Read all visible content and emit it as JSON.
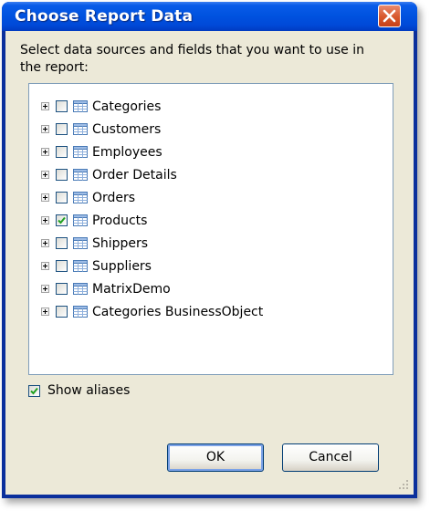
{
  "window": {
    "title": "Choose Report Data"
  },
  "description": "Select data sources and fields that you want to use in the report:",
  "tree": {
    "items": [
      {
        "label": "Categories",
        "checked": false
      },
      {
        "label": "Customers",
        "checked": false
      },
      {
        "label": "Employees",
        "checked": false
      },
      {
        "label": "Order Details",
        "checked": false
      },
      {
        "label": "Orders",
        "checked": false
      },
      {
        "label": "Products",
        "checked": true
      },
      {
        "label": "Shippers",
        "checked": false
      },
      {
        "label": "Suppliers",
        "checked": false
      },
      {
        "label": "MatrixDemo",
        "checked": false
      },
      {
        "label": "Categories BusinessObject",
        "checked": false
      }
    ]
  },
  "options": {
    "show_aliases_label": "Show aliases",
    "show_aliases_checked": true
  },
  "buttons": {
    "ok": "OK",
    "cancel": "Cancel"
  },
  "colors": {
    "titlebar": "#0053e0",
    "client": "#ece9d8",
    "check": "#21a121",
    "close": "#d8582b"
  }
}
